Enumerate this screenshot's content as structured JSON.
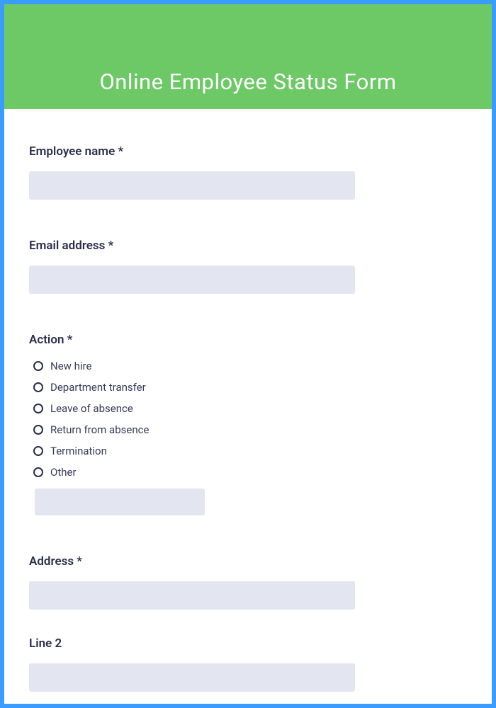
{
  "header": {
    "title": "Online Employee Status Form"
  },
  "fields": {
    "employee_name": {
      "label": "Employee name *",
      "value": ""
    },
    "email": {
      "label": "Email address *",
      "value": ""
    },
    "action": {
      "label": "Action *",
      "options": [
        "New hire",
        "Department transfer",
        "Leave of absence",
        "Return from absence",
        "Termination",
        "Other"
      ],
      "other_value": ""
    },
    "address": {
      "label": "Address *",
      "value": ""
    },
    "line2": {
      "label": "Line 2",
      "value": ""
    }
  }
}
